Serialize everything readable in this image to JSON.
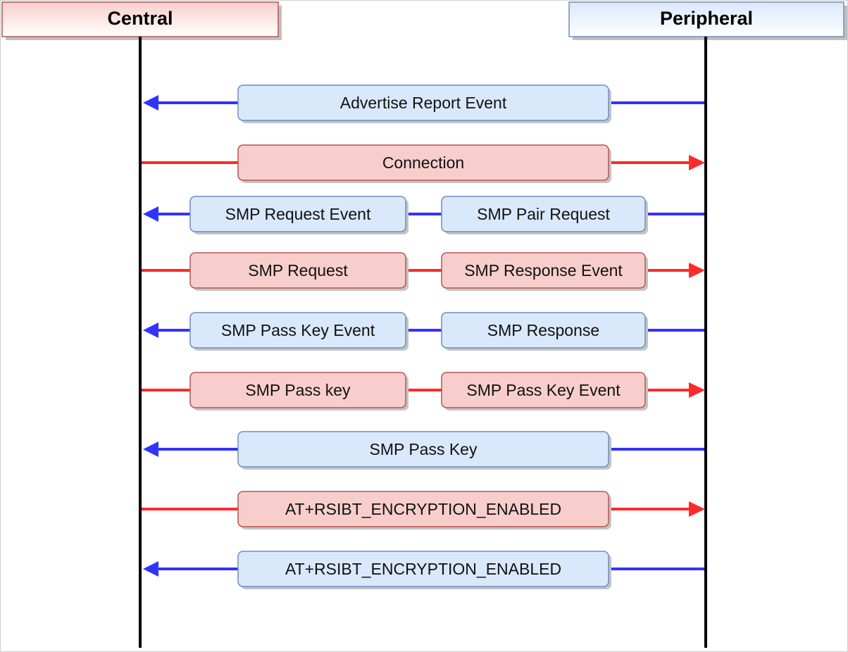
{
  "participants": {
    "central": "Central",
    "peripheral": "Peripheral"
  },
  "colors": {
    "central_header": "#f8cecc",
    "peripheral_header": "#dae8fc",
    "blue_fill": "#dae8fc",
    "blue_stroke": "#6c8ebf",
    "blue_line": "#3333ff",
    "red_fill": "#f8cecc",
    "red_stroke": "#b85450",
    "red_line": "#ff2a2a",
    "lifeline": "#000000"
  },
  "messages": [
    {
      "direction": "to-central",
      "color": "blue",
      "labels": [
        "Advertise Report Event"
      ]
    },
    {
      "direction": "to-peripheral",
      "color": "red",
      "labels": [
        "Connection"
      ]
    },
    {
      "direction": "to-central",
      "color": "blue",
      "labels": [
        "SMP Request Event",
        "SMP Pair Request"
      ]
    },
    {
      "direction": "to-peripheral",
      "color": "red",
      "labels": [
        "SMP Request",
        "SMP Response Event"
      ]
    },
    {
      "direction": "to-central",
      "color": "blue",
      "labels": [
        "SMP Pass Key Event",
        "SMP Response"
      ]
    },
    {
      "direction": "to-peripheral",
      "color": "red",
      "labels": [
        "SMP Pass key",
        "SMP Pass Key Event"
      ]
    },
    {
      "direction": "to-central",
      "color": "blue",
      "labels": [
        "SMP Pass Key"
      ]
    },
    {
      "direction": "to-peripheral",
      "color": "red",
      "labels": [
        "AT+RSIBT_ENCRYPTION_ENABLED"
      ]
    },
    {
      "direction": "to-central",
      "color": "blue",
      "labels": [
        "AT+RSIBT_ENCRYPTION_ENABLED"
      ]
    }
  ]
}
